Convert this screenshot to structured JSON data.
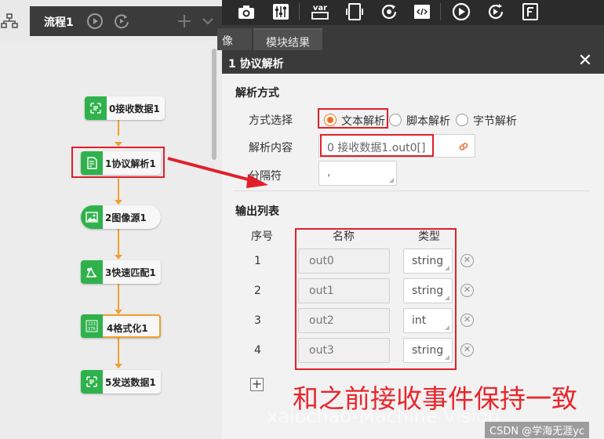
{
  "flow": {
    "tab_label": "流程1",
    "nodes": [
      {
        "label": "0接收数据1"
      },
      {
        "label": "1协议解析1"
      },
      {
        "label": "2图像源1"
      },
      {
        "label": "3快速匹配1"
      },
      {
        "label": "4格式化1"
      },
      {
        "label": "5发送数据1"
      }
    ]
  },
  "toolbar": {
    "tools": [
      "camera-icon",
      "sliders-icon",
      "var-icon",
      "device-icon",
      "refresh-target-icon",
      "script-icon",
      "play-icon",
      "cycle-run-icon",
      "file-f-icon"
    ],
    "var_text": "var"
  },
  "tabs": {
    "image_tab": "像",
    "results_tab": "模块结果"
  },
  "dialog": {
    "title": "1 协议解析",
    "close_symbol": "✕",
    "parse_section": "解析方式",
    "mode_label": "方式选择",
    "modes": [
      "文本解析",
      "脚本解析",
      "字节解析"
    ],
    "selected_mode": "文本解析",
    "content_label": "解析内容",
    "content_value": "0 接收数据1.out0[]",
    "separator_label": "分隔符",
    "separator_value": ",",
    "output_section": "输出列表",
    "columns": {
      "index": "序号",
      "name": "名称",
      "type": "类型"
    },
    "rows": [
      {
        "index": "1",
        "name": "out0",
        "type": "string"
      },
      {
        "index": "2",
        "name": "out1",
        "type": "string"
      },
      {
        "index": "3",
        "name": "out2",
        "type": "int"
      },
      {
        "index": "4",
        "name": "out3",
        "type": "string"
      }
    ],
    "add_symbol": "+"
  },
  "annotation_text": "和之前接收事件保持一致",
  "watermark": "xaiochao-Machine Vision",
  "credit": "CSDN @学海无涯yc",
  "colors": {
    "accent": "#f07020",
    "node_green": "#2fb24c",
    "connector": "#f0a030",
    "annotation_red": "#e0202a"
  }
}
